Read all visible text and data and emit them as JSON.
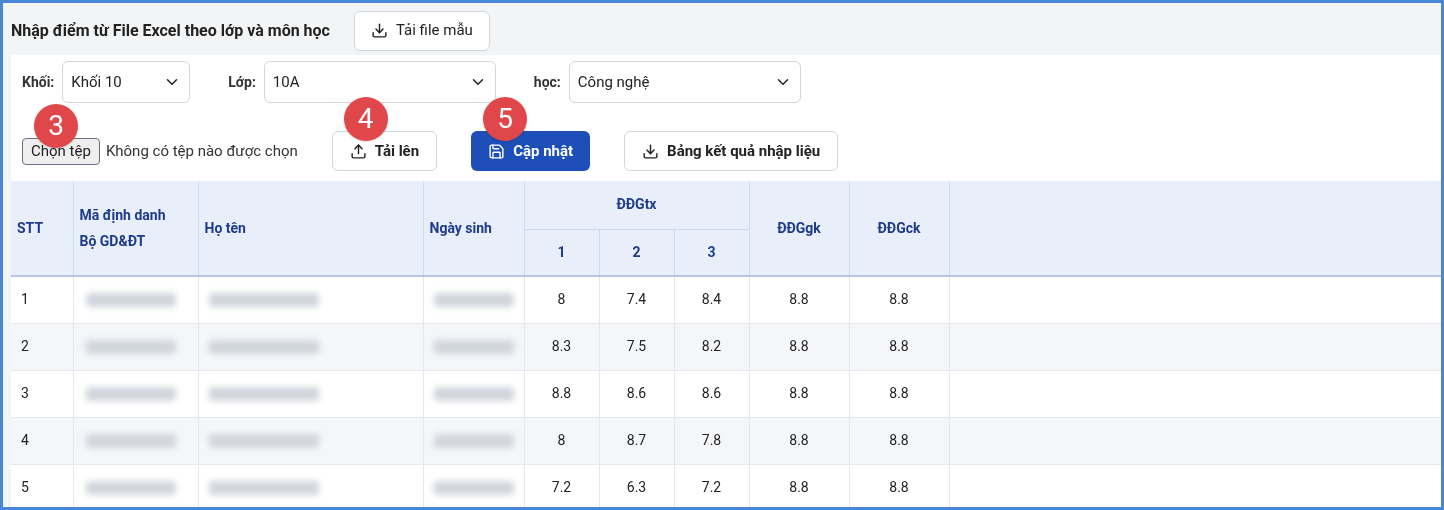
{
  "title": "Nhập điểm từ File Excel theo lớp và môn học",
  "template_button": "Tải file mẫu",
  "filters": [
    {
      "label": "Khối:",
      "value": "Khối 10"
    },
    {
      "label": "Lớp:",
      "value": "10A"
    },
    {
      "label": "học:",
      "value": "Công nghệ"
    }
  ],
  "file_picker": {
    "button": "Chọn tệp",
    "status": "Không có tệp nào được chọn",
    "badge": "3"
  },
  "actions": [
    {
      "label": "Tải lên",
      "kind": "upload",
      "primary": false,
      "badge": "4"
    },
    {
      "label": "Cập nhật",
      "kind": "save",
      "primary": true,
      "badge": "5"
    },
    {
      "label": "Bảng kết quả nhập liệu",
      "kind": "download",
      "primary": false
    }
  ],
  "table": {
    "columns": [
      "STT",
      "Mã định danh Bộ GD&ĐT",
      "Họ tên",
      "Ngày sinh"
    ],
    "group": {
      "label": "ĐĐGtx",
      "sub": [
        "1",
        "2",
        "3"
      ]
    },
    "tail_columns": [
      "ĐĐGgk",
      "ĐĐGck"
    ],
    "rows": [
      {
        "stt": "1",
        "scores": [
          "8",
          "7.4",
          "8.4",
          "8.8",
          "8.8"
        ]
      },
      {
        "stt": "2",
        "scores": [
          "8.3",
          "7.5",
          "8.2",
          "8.8",
          "8.8"
        ]
      },
      {
        "stt": "3",
        "scores": [
          "8.8",
          "8.6",
          "8.6",
          "8.8",
          "8.8"
        ]
      },
      {
        "stt": "4",
        "scores": [
          "8",
          "8.7",
          "7.8",
          "8.8",
          "8.8"
        ]
      },
      {
        "stt": "5",
        "scores": [
          "7.2",
          "6.3",
          "7.2",
          "8.8",
          "8.8"
        ]
      }
    ]
  }
}
